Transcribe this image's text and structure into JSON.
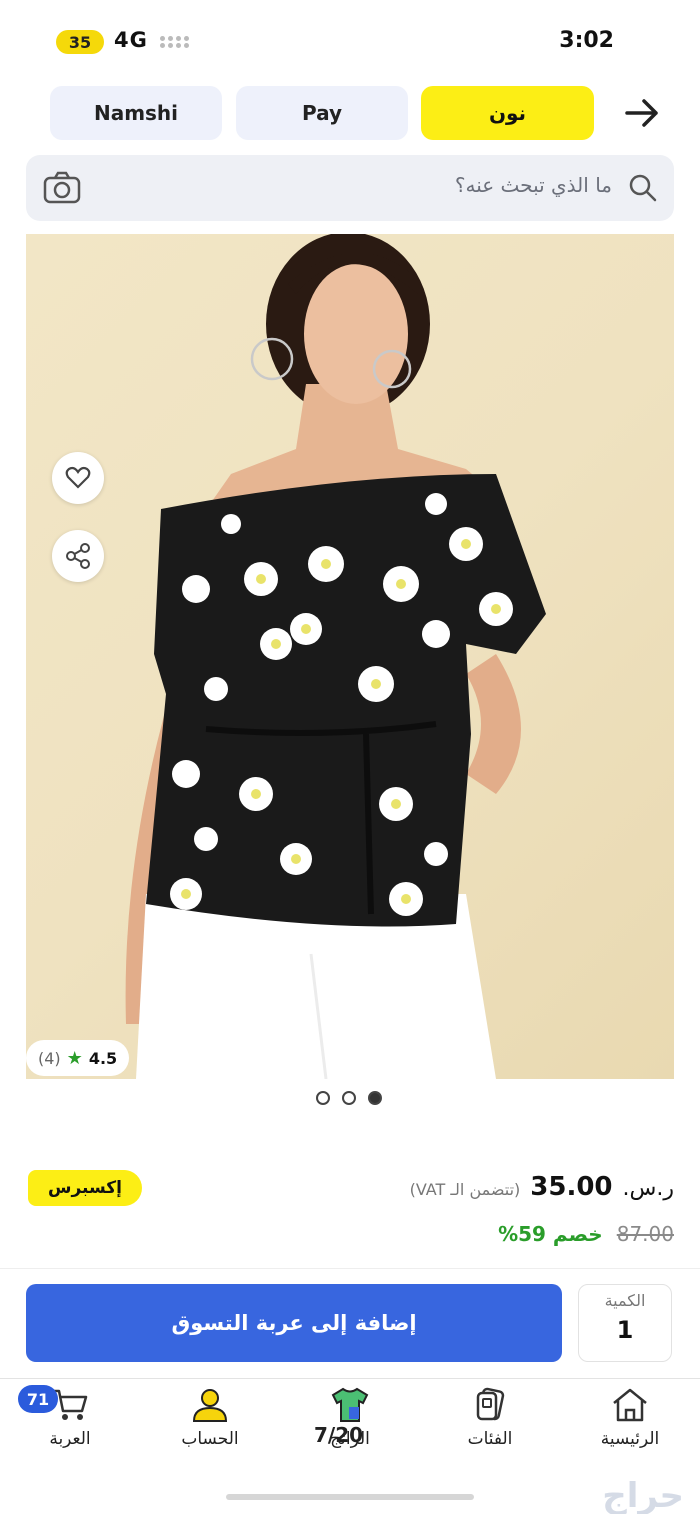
{
  "status_bar": {
    "battery": "35",
    "network": "4G",
    "time": "3:02"
  },
  "tabs": {
    "namshi": "Namshi",
    "pay": "Pay",
    "noon": "نون"
  },
  "search": {
    "placeholder": "ما الذي تبحث عنه؟"
  },
  "product": {
    "rating": "4.5",
    "rating_count": "(4)",
    "image_pages": 3,
    "active_page": 3,
    "express_label": "إكسبرس",
    "price": "35.00",
    "currency": "ر.س.",
    "vat_note": "(تتضمن الـ VAT)",
    "old_price": "87.00",
    "discount": "خصم 59%"
  },
  "actions": {
    "add_to_cart": "إضافة إلى عربة التسوق",
    "quantity_label": "الكمية",
    "quantity_value": "1"
  },
  "bottom_nav": {
    "cart": "العربة",
    "cart_badge": "71",
    "account": "الحساب",
    "trending": "الرائج",
    "categories": "الفئات",
    "home": "الرئيسية",
    "counter": "7/20"
  },
  "watermark": "حراج",
  "colors": {
    "noon_yellow": "#fcee15",
    "primary_blue": "#3866df",
    "discount_green": "#2a9d2a"
  }
}
